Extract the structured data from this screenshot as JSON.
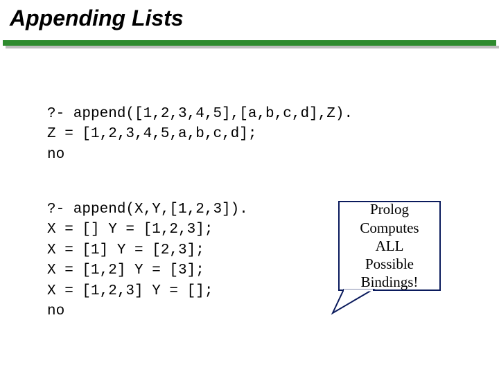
{
  "title": "Appending Lists",
  "code1": "?- append([1,2,3,4,5],[a,b,c,d],Z).\nZ = [1,2,3,4,5,a,b,c,d];\nno",
  "code2": "?- append(X,Y,[1,2,3]).\nX = [] Y = [1,2,3];\nX = [1] Y = [2,3];\nX = [1,2] Y = [3];\nX = [1,2,3] Y = [];\nno",
  "callout": "Prolog\nComputes\nALL\nPossible\nBindings!"
}
